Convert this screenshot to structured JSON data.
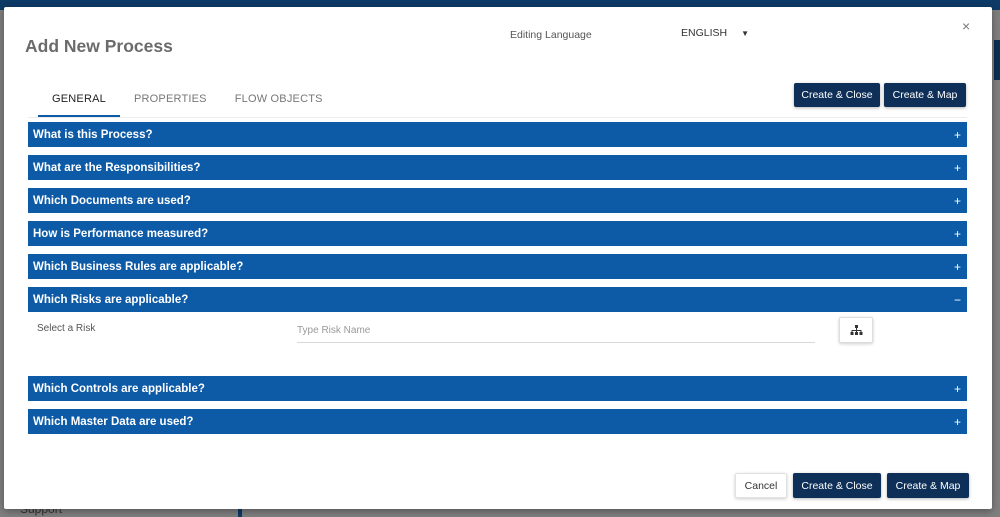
{
  "background": {
    "support_label": "Support"
  },
  "dialog": {
    "title": "Add New Process",
    "language_label": "Editing Language",
    "language_value": "ENGLISH",
    "close_glyph": "×"
  },
  "tabs": [
    {
      "label": "GENERAL",
      "active": true
    },
    {
      "label": "PROPERTIES",
      "active": false
    },
    {
      "label": "FLOW OBJECTS",
      "active": false
    }
  ],
  "actions": {
    "create_close": "Create & Close",
    "create_map": "Create & Map",
    "cancel": "Cancel"
  },
  "sections": [
    {
      "title": "What is this Process?",
      "icon": "+"
    },
    {
      "title": "What are the Responsibilities?",
      "icon": "+"
    },
    {
      "title": "Which Documents are used?",
      "icon": "+"
    },
    {
      "title": "How is Performance measured?",
      "icon": "+"
    },
    {
      "title": "Which Business Rules are applicable?",
      "icon": "+"
    },
    {
      "title": "Which Risks are applicable?",
      "icon": "−"
    },
    {
      "title": "Which Controls are applicable?",
      "icon": "+"
    },
    {
      "title": "Which Master Data are used?",
      "icon": "+"
    }
  ],
  "risk": {
    "label": "Select a Risk",
    "placeholder": "Type Risk Name",
    "value": ""
  },
  "colors": {
    "accent": "#0d5aa7",
    "button_dark": "#0e2f57",
    "topbar": "#0d3a66"
  }
}
